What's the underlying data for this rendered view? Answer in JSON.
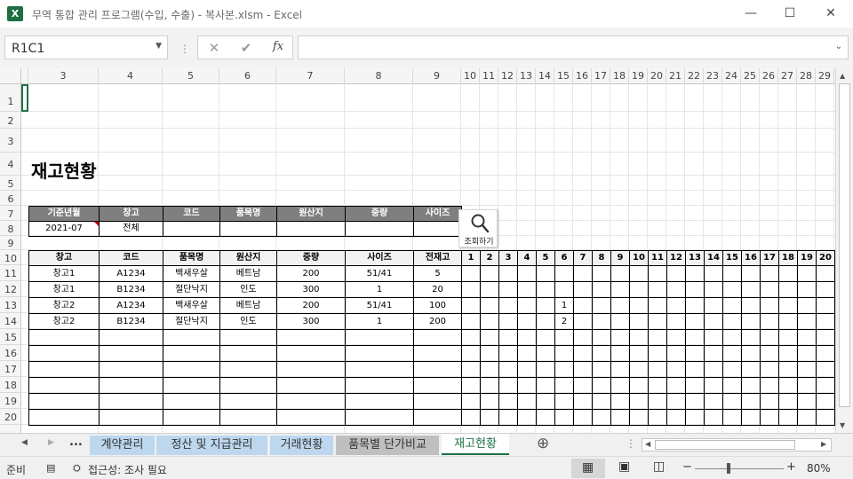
{
  "window": {
    "title": "무역 통합 관리 프로그램(수입, 수출) - 복사본.xlsm - Excel",
    "app_icon_letter": "X",
    "min_icon": "—",
    "max_icon": "☐",
    "close_icon": "✕"
  },
  "formula_bar": {
    "name_box": "R1C1",
    "cancel_icon": "✕",
    "enter_icon": "✔",
    "fx_label": "fx",
    "formula_value": ""
  },
  "grid": {
    "columns": [
      "3",
      "4",
      "5",
      "6",
      "7",
      "8",
      "9",
      "10",
      "11",
      "12",
      "13",
      "14",
      "15",
      "16",
      "17",
      "18",
      "19",
      "20",
      "21",
      "22",
      "23",
      "24",
      "25",
      "26",
      "27",
      "28",
      "29"
    ],
    "rows": [
      "1",
      "2",
      "3",
      "4",
      "5",
      "6",
      "7",
      "8",
      "9",
      "10",
      "11",
      "12",
      "13",
      "14",
      "15",
      "16",
      "17",
      "18",
      "19",
      "20"
    ]
  },
  "sheet": {
    "title": "재고현황",
    "filter": {
      "headers": [
        "기준년월",
        "창고",
        "코드",
        "품목명",
        "원산지",
        "중량",
        "사이즈"
      ],
      "values": [
        "2021-07",
        "전체",
        "",
        "",
        "",
        "",
        ""
      ]
    },
    "search_button": {
      "label": "조회하기",
      "icon": "search-icon"
    },
    "table": {
      "headers": [
        "창고",
        "코드",
        "품목명",
        "원산지",
        "중량",
        "사이즈",
        "전재고"
      ],
      "day_headers": [
        "1",
        "2",
        "3",
        "4",
        "5",
        "6",
        "7",
        "8",
        "9",
        "10",
        "11",
        "12",
        "13",
        "14",
        "15",
        "16",
        "17",
        "18",
        "19",
        "20"
      ],
      "rows": [
        {
          "cells": [
            "창고1",
            "A1234",
            "백새우살",
            "베트남",
            "200",
            "51/41",
            "5"
          ],
          "days": {}
        },
        {
          "cells": [
            "창고1",
            "B1234",
            "절단낙지",
            "인도",
            "300",
            "1",
            "20"
          ],
          "days": {}
        },
        {
          "cells": [
            "창고2",
            "A1234",
            "백새우살",
            "베트남",
            "200",
            "51/41",
            "100"
          ],
          "days": {
            "6": "1"
          }
        },
        {
          "cells": [
            "창고2",
            "B1234",
            "절단낙지",
            "인도",
            "300",
            "1",
            "200"
          ],
          "days": {
            "6": "2"
          }
        }
      ],
      "empty_rows": 6
    }
  },
  "tabs": {
    "nav_prev": "◀",
    "nav_next": "▶",
    "more": "...",
    "items": [
      {
        "label": "계약관리",
        "color": "#bdd7ee"
      },
      {
        "label": "정산 및 지급관리",
        "color": "#bdd7ee"
      },
      {
        "label": "거래현황",
        "color": "#bdd7ee"
      },
      {
        "label": "품목별 단가비교",
        "color": "#bfbfbf"
      },
      {
        "label": "재고현황",
        "color": "#ffffff"
      }
    ],
    "add_icon": "⊕"
  },
  "status": {
    "ready": "준비",
    "accessibility": "접근성: 조사 필요",
    "zoom": "80%",
    "zoom_minus": "−",
    "zoom_plus": "+"
  }
}
